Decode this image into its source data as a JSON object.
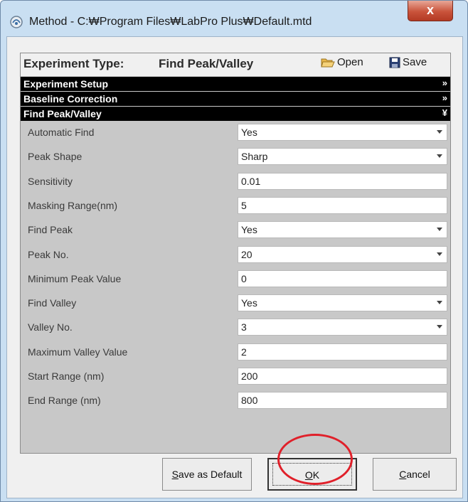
{
  "window": {
    "title": "Method - C:₩Program Files₩LabPro Plus₩Default.mtd",
    "close_label": "x"
  },
  "header": {
    "experiment_type_label": "Experiment Type:",
    "experiment_type_value": "Find Peak/Valley",
    "open_label": "Open",
    "save_label": "Save"
  },
  "sections": [
    {
      "label": "Experiment Setup",
      "chevron": "»"
    },
    {
      "label": "Baseline Correction",
      "chevron": "»"
    },
    {
      "label": "Find Peak/Valley",
      "chevron": "¥"
    }
  ],
  "properties": [
    {
      "label": "Automatic Find",
      "value": "Yes",
      "dropdown": true
    },
    {
      "label": "Peak Shape",
      "value": "Sharp",
      "dropdown": true
    },
    {
      "label": "Sensitivity",
      "value": "0.01",
      "dropdown": false
    },
    {
      "label": "Masking Range(nm)",
      "value": "5",
      "dropdown": false
    },
    {
      "label": "Find Peak",
      "value": "Yes",
      "dropdown": true
    },
    {
      "label": "Peak No.",
      "value": "20",
      "dropdown": true
    },
    {
      "label": "Minimum Peak Value",
      "value": "0",
      "dropdown": false
    },
    {
      "label": "Find Valley",
      "value": "Yes",
      "dropdown": true
    },
    {
      "label": "Valley No.",
      "value": "3",
      "dropdown": true
    },
    {
      "label": "Maximum Valley Value",
      "value": "2",
      "dropdown": false
    },
    {
      "label": "Start Range (nm)",
      "value": "200",
      "dropdown": false
    },
    {
      "label": "End Range (nm)",
      "value": "800",
      "dropdown": false
    }
  ],
  "buttons": {
    "save_default_first": "S",
    "save_default_rest": "ave as Default",
    "ok_first": "O",
    "ok_rest": "K",
    "cancel_first": "C",
    "cancel_rest": "ancel"
  },
  "colors": {
    "section_bar": "#000000",
    "panel_bg": "#c8c8c8",
    "annotation": "#e0202a"
  }
}
